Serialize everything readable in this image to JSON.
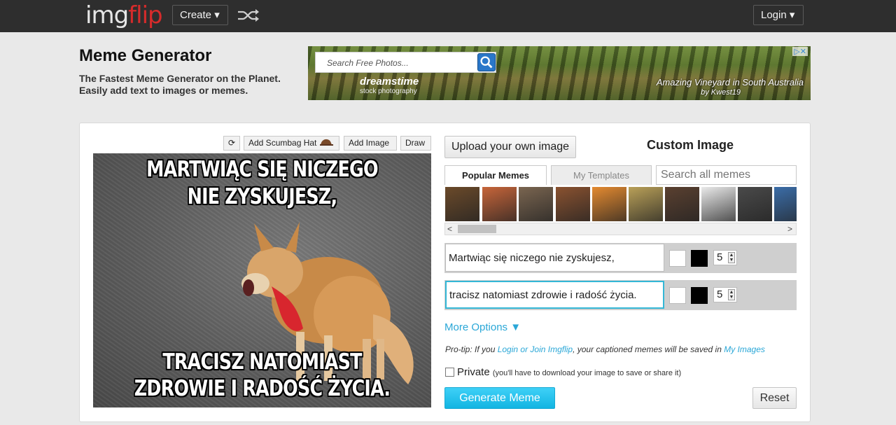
{
  "topbar": {
    "logo_part1": "img",
    "logo_part2": "flip",
    "create_label": "Create ▾",
    "login_label": "Login ▾",
    "shuffle_icon": "shuffle-icon",
    "colors": {
      "bar": "#2e2e2e",
      "logo_accent": "#d62b2b"
    }
  },
  "header": {
    "title": "Meme Generator",
    "tagline_line1": "The Fastest Meme Generator on the Planet.",
    "tagline_line2": "Easily add text to images or memes."
  },
  "ad": {
    "search_placeholder": "Search Free Photos...",
    "brand": "dreamstime",
    "brand_sub": "stock photography",
    "caption": "Amazing Vineyard in South Australia",
    "credit": "by Kwest19",
    "adchoices": "▷✕"
  },
  "toolbar": {
    "rotate_icon": "rotate-icon",
    "rotate_label": "⟳",
    "scumbag_label": "Add Scumbag Hat",
    "add_image_label": "Add Image",
    "draw_label": "Draw"
  },
  "meme": {
    "top_line1": "MARTWIĄC SIĘ NICZEGO",
    "top_line2": "NIE ZYSKUJESZ,",
    "bottom_line1": "TRACISZ NATOMIAST",
    "bottom_line2": "ZDROWIE I RADOŚĆ ŻYCIA."
  },
  "sidebar": {
    "upload_label": "Upload your own image",
    "custom_title": "Custom Image",
    "tabs": [
      {
        "label": "Popular Memes",
        "active": true
      },
      {
        "label": "My Templates",
        "active": false
      }
    ],
    "search_placeholder": "Search all memes",
    "thumb_colors": [
      "#6b4a2a",
      "#c7653a",
      "#7a6550",
      "#8a5230",
      "#e48a30",
      "#b9a058",
      "#5a4030",
      "#eaeaea",
      "#4a4a4a",
      "#3b6da8",
      "#6a4a35"
    ]
  },
  "text_boxes": [
    {
      "value": "Martwiąc się niczego nie zyskujesz,",
      "size": "5"
    },
    {
      "value": "tracisz natomiast zdrowie i radość życia.",
      "size": "5"
    }
  ],
  "options": {
    "more_options": "More Options ▼",
    "protip_prefix": "Pro-tip: If you ",
    "protip_link1": "Login or Join Imgflip",
    "protip_mid": ", your captioned memes will be saved in ",
    "protip_link2": "My Images",
    "private_label": "Private",
    "private_note": "(you'll have to download your image to save or share it)"
  },
  "actions": {
    "generate_label": "Generate Meme",
    "reset_label": "Reset",
    "accent_color": "#12b5e2"
  }
}
